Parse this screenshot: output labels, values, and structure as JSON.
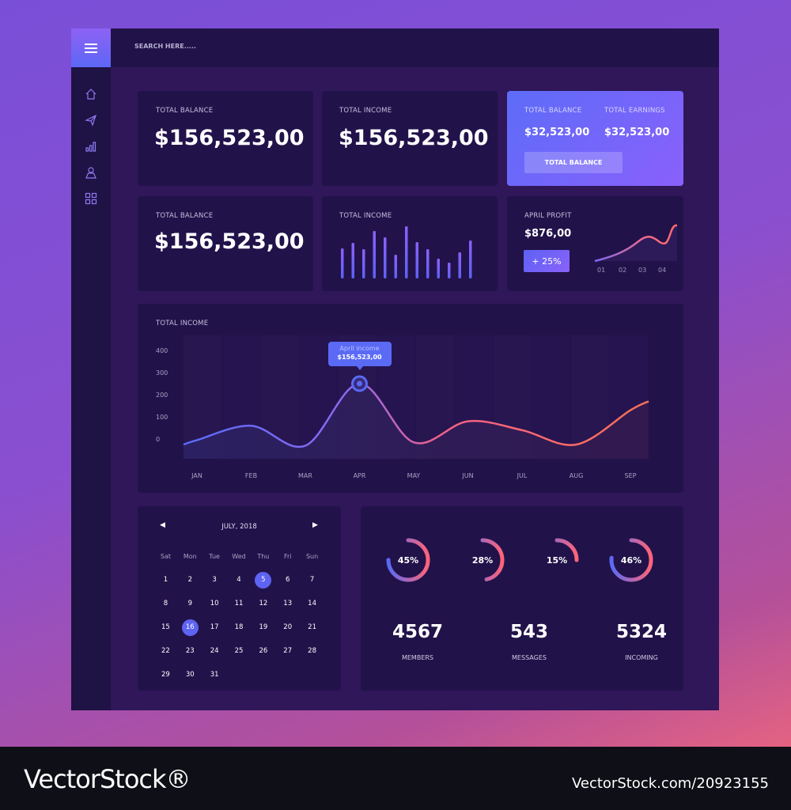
{
  "search": {
    "placeholder": "SEARCH HERE....."
  },
  "sidebar": {
    "items": [
      {
        "icon": "home-icon"
      },
      {
        "icon": "send-icon"
      },
      {
        "icon": "bar-chart-icon"
      },
      {
        "icon": "user-icon"
      },
      {
        "icon": "grid-icon"
      }
    ]
  },
  "cards": {
    "c1": {
      "label": "TOTAL BALANCE",
      "value": "$156,523,00"
    },
    "c2": {
      "label": "TOTAL INCOME",
      "value": "$156,523,00"
    },
    "c3": {
      "label1": "TOTAL BALANCE",
      "value1": "$32,523,00",
      "label2": "TOTAL EARNINGS",
      "value2": "$32,523,00",
      "button": "TOTAL BALANCE"
    },
    "c4": {
      "label": "TOTAL BALANCE",
      "value": "$156,523,00"
    },
    "c5": {
      "label": "TOTAL INCOME",
      "bars": [
        38,
        45,
        37,
        60,
        52,
        30,
        66,
        46,
        37,
        25,
        20,
        33,
        48
      ]
    },
    "c6": {
      "label": "APRIL PROFIT",
      "value": "$876,00",
      "change": "+ 25%",
      "x_labels": [
        "01",
        "02",
        "03",
        "04"
      ]
    }
  },
  "chart_data": {
    "type": "line",
    "title": "TOTAL INCOME",
    "categories": [
      "JAN",
      "FEB",
      "MAR",
      "APR",
      "MAY",
      "JUN",
      "JUL",
      "AUG",
      "SEP"
    ],
    "values": [
      -5,
      60,
      -30,
      250,
      -15,
      80,
      40,
      -25,
      130
    ],
    "yticks": [
      400,
      300,
      200,
      100,
      0
    ],
    "ylim": [
      -90,
      460
    ],
    "tooltip": {
      "title": "April income",
      "value": "$156,523,00",
      "category": "APR"
    },
    "colors": {
      "start": "#5a6af5",
      "end": "#f76a6a"
    }
  },
  "calendar": {
    "month": "JULY, 2018",
    "weekdays": [
      "Sat",
      "Mon",
      "Tue",
      "Wed",
      "Thu",
      "Fri",
      "Sun"
    ],
    "days": [
      1,
      2,
      3,
      4,
      5,
      6,
      7,
      8,
      9,
      10,
      11,
      12,
      13,
      14,
      15,
      16,
      17,
      18,
      19,
      20,
      21,
      22,
      23,
      24,
      25,
      26,
      27,
      28,
      29,
      30,
      31
    ],
    "selected": [
      5,
      16
    ]
  },
  "donuts": [
    {
      "label": "45%",
      "value": 45
    },
    {
      "label": "28%",
      "value": 28
    },
    {
      "label": "15%",
      "value": 15
    },
    {
      "label": "46%",
      "value": 46
    }
  ],
  "stats": [
    {
      "value": "4567",
      "label": "MEMBERS"
    },
    {
      "value": "543",
      "label": "MESSAGES"
    },
    {
      "value": "5324",
      "label": "INCOMING"
    }
  ],
  "footer": {
    "logo": "VectorStock®",
    "id": "VectorStock.com/20923155"
  }
}
